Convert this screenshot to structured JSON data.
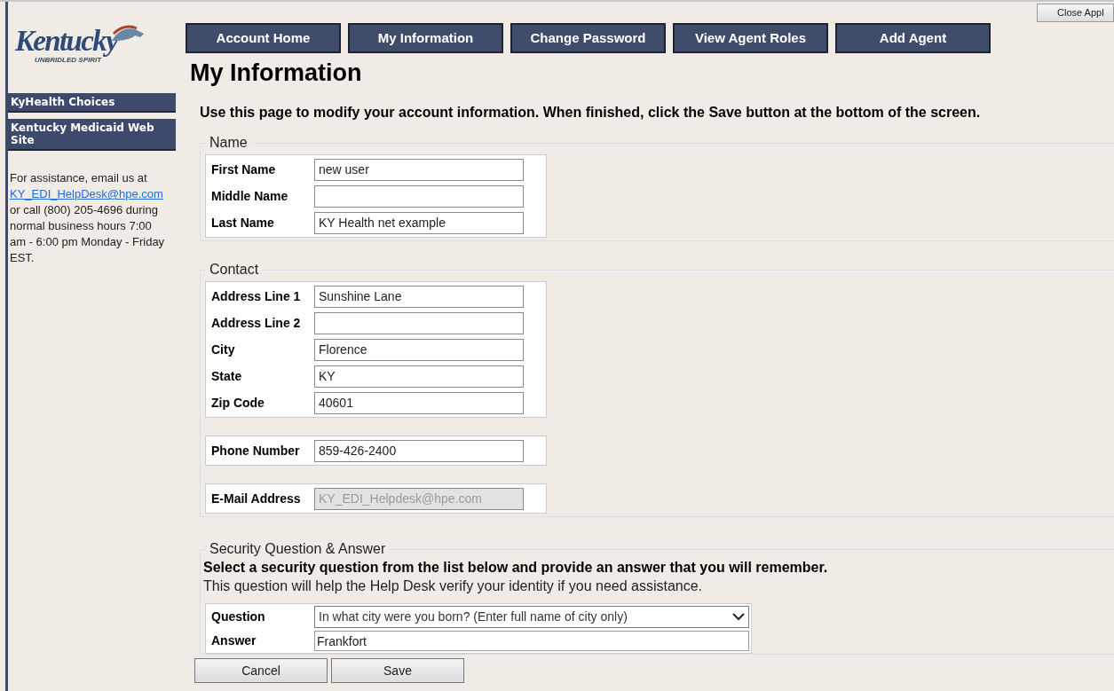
{
  "close_button": "Close Appl",
  "logo": {
    "text": "Kentucky",
    "tagline": "UNBRIDLED SPIRIT"
  },
  "nav": [
    "Account Home",
    "My Information",
    "Change Password",
    "View Agent Roles",
    "Add Agent"
  ],
  "sidebar": {
    "links": [
      "KyHealth Choices",
      "Kentucky Medicaid Web Site"
    ],
    "help_before": "For assistance, email us at",
    "help_email": "KY_EDI_HelpDesk@hpe.com",
    "help_after": "or call (800) 205-4696 during normal business hours 7:00 am - 6:00 pm Monday - Friday EST."
  },
  "title": "My Information",
  "instructions": "Use this page to modify your account information. When finished, click the Save button at the bottom of the screen.",
  "sections": [
    {
      "legend": "Name",
      "groups": [
        [
          {
            "label": "First Name",
            "value": "new user",
            "disabled": false
          },
          {
            "label": "Middle Name",
            "disabled": false
          },
          {
            "label": "Last Name",
            "value": "KY Health net example",
            "disabled": false
          }
        ]
      ]
    },
    {
      "legend": "Contact",
      "groups": [
        [
          {
            "label": "Address Line 1",
            "value": "Sunshine Lane",
            "disabled": false
          },
          {
            "label": "Address Line 2",
            "disabled": false
          },
          {
            "label": "City",
            "value": "Florence",
            "disabled": false
          },
          {
            "label": "State",
            "value": "KY",
            "disabled": false
          },
          {
            "label": "Zip Code",
            "value": "40601",
            "disabled": false
          }
        ],
        [
          {
            "label": "Phone Number",
            "value": "859-426-2400",
            "disabled": false
          }
        ],
        [
          {
            "label": "E-Mail Address",
            "value": "KY_EDI_Helpdesk@hpe.com",
            "disabled": true
          }
        ]
      ]
    }
  ],
  "security": {
    "legend": "Security Question & Answer",
    "heading": "Select a security question from the list below and provide an answer that you will remember.",
    "note": "This question will help the Help Desk verify your identity if you need assistance.",
    "question_label": "Question",
    "question": "In what city were you born? (Enter full name of city only)",
    "answer_label": "Answer",
    "answer": "Frankfort"
  },
  "buttons": [
    "Cancel",
    "Save"
  ]
}
